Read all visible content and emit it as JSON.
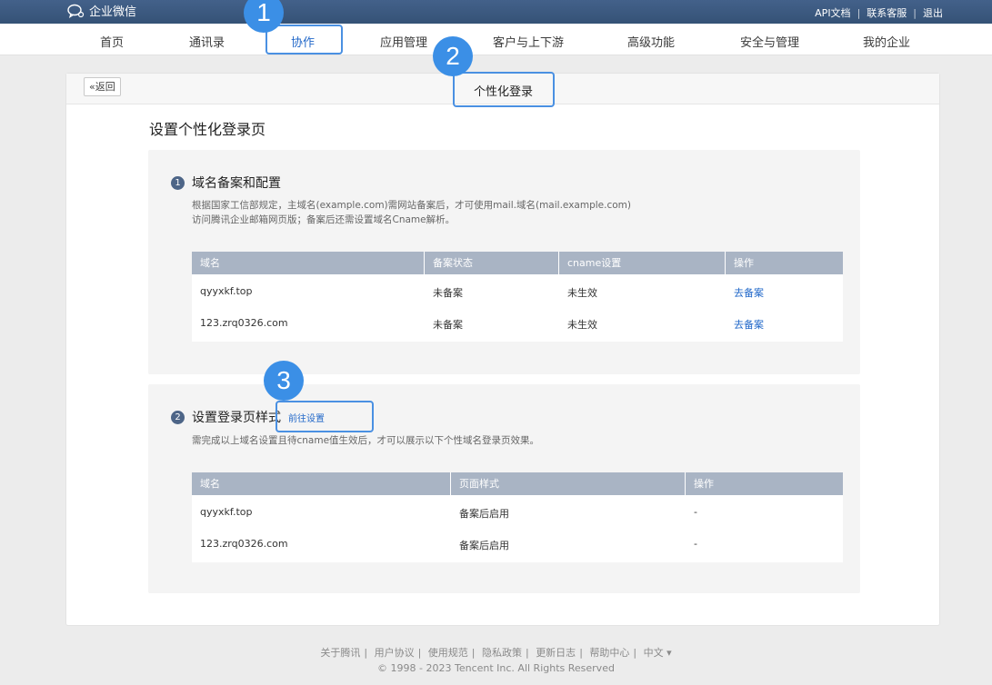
{
  "app": {
    "name": "企业微信"
  },
  "top_links": [
    "API文档",
    "联系客服",
    "退出"
  ],
  "nav": {
    "items": [
      "首页",
      "通讯录",
      "协作",
      "应用管理",
      "客户与上下游",
      "高级功能",
      "安全与管理",
      "我的企业"
    ],
    "active_index": 2
  },
  "card": {
    "back_label": "«返回",
    "title": "个性化登录",
    "page_title": "设置个性化登录页"
  },
  "section1": {
    "number": "1",
    "title": "域名备案和配置",
    "desc_line1": "根据国家工信部规定，主域名(example.com)需网站备案后，才可使用mail.域名(mail.example.com)",
    "desc_line2": "访问腾讯企业邮箱网页版；备案后还需设置域名Cname解析。",
    "columns": [
      "域名",
      "备案状态",
      "cname设置",
      "操作"
    ],
    "rows": [
      {
        "domain": "qyyxkf.top",
        "status": "未备案",
        "cname": "未生效",
        "action": "去备案"
      },
      {
        "domain": "123.zrq0326.com",
        "status": "未备案",
        "cname": "未生效",
        "action": "去备案"
      }
    ]
  },
  "section2": {
    "number": "2",
    "title": "设置登录页样式",
    "link": "前往设置",
    "desc": "需完成以上域名设置且待cname值生效后，才可以展示以下个性域名登录页效果。",
    "columns": [
      "域名",
      "页面样式",
      "操作"
    ],
    "rows": [
      {
        "domain": "qyyxkf.top",
        "style": "备案后启用",
        "action": "-"
      },
      {
        "domain": "123.zrq0326.com",
        "style": "备案后启用",
        "action": "-"
      }
    ]
  },
  "footer": {
    "links": [
      "关于腾讯",
      "用户协议",
      "使用规范",
      "隐私政策",
      "更新日志",
      "帮助中心",
      "中文 ▾"
    ],
    "copyright": "© 1998 - 2023 Tencent Inc. All Rights Reserved"
  },
  "annotations": [
    "1",
    "2",
    "3"
  ],
  "colors": {
    "topbar": "#3d5a80",
    "link": "#2268c9",
    "highlight": "#4a90e2",
    "table_header": "#a9b4c4"
  }
}
